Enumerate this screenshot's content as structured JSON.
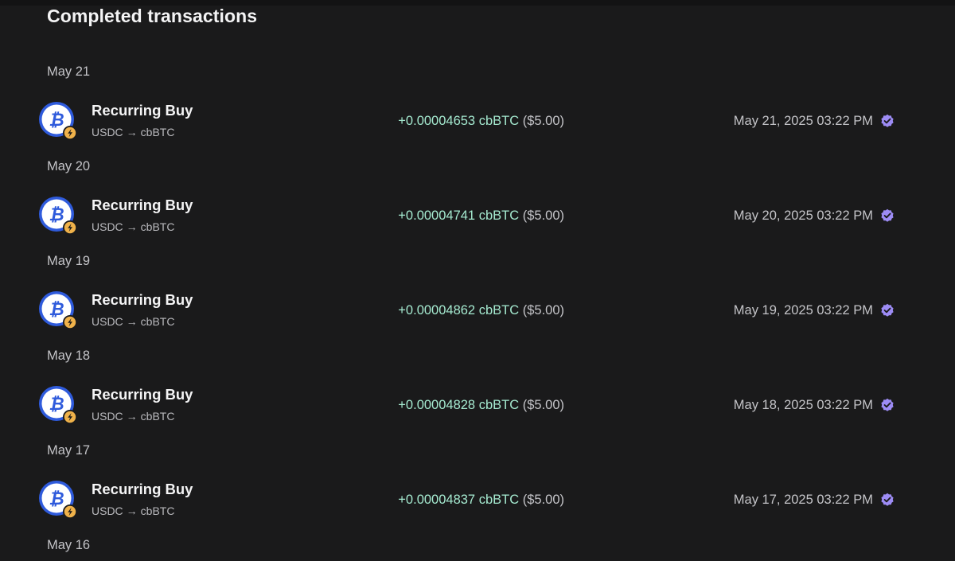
{
  "page": {
    "title": "Completed transactions"
  },
  "colors": {
    "background": "#1a1a1b",
    "amount_positive": "#a5ead0",
    "secondary_text": "#c4c4c8",
    "verified_badge": "#9d8cf5",
    "btc_blue": "#2f5bdc",
    "bolt_badge": "#f0b24a"
  },
  "groups": [
    {
      "date": "May 21",
      "transactions": [
        {
          "icon": "bitcoin-icon",
          "badge_icon": "lightning-bolt-icon",
          "title": "Recurring Buy",
          "from": "USDC",
          "arrow": "→",
          "to": "cbBTC",
          "amount": "+0.00004653 cbBTC",
          "usd": "($5.00)",
          "timestamp": "May 21, 2025 03:22 PM",
          "status_icon": "verified-check-icon"
        }
      ]
    },
    {
      "date": "May 20",
      "transactions": [
        {
          "icon": "bitcoin-icon",
          "badge_icon": "lightning-bolt-icon",
          "title": "Recurring Buy",
          "from": "USDC",
          "arrow": "→",
          "to": "cbBTC",
          "amount": "+0.00004741 cbBTC",
          "usd": "($5.00)",
          "timestamp": "May 20, 2025 03:22 PM",
          "status_icon": "verified-check-icon"
        }
      ]
    },
    {
      "date": "May 19",
      "transactions": [
        {
          "icon": "bitcoin-icon",
          "badge_icon": "lightning-bolt-icon",
          "title": "Recurring Buy",
          "from": "USDC",
          "arrow": "→",
          "to": "cbBTC",
          "amount": "+0.00004862 cbBTC",
          "usd": "($5.00)",
          "timestamp": "May 19, 2025 03:22 PM",
          "status_icon": "verified-check-icon"
        }
      ]
    },
    {
      "date": "May 18",
      "transactions": [
        {
          "icon": "bitcoin-icon",
          "badge_icon": "lightning-bolt-icon",
          "title": "Recurring Buy",
          "from": "USDC",
          "arrow": "→",
          "to": "cbBTC",
          "amount": "+0.00004828 cbBTC",
          "usd": "($5.00)",
          "timestamp": "May 18, 2025 03:22 PM",
          "status_icon": "verified-check-icon"
        }
      ]
    },
    {
      "date": "May 17",
      "transactions": [
        {
          "icon": "bitcoin-icon",
          "badge_icon": "lightning-bolt-icon",
          "title": "Recurring Buy",
          "from": "USDC",
          "arrow": "→",
          "to": "cbBTC",
          "amount": "+0.00004837 cbBTC",
          "usd": "($5.00)",
          "timestamp": "May 17, 2025 03:22 PM",
          "status_icon": "verified-check-icon"
        }
      ]
    },
    {
      "date": "May 16",
      "transactions": []
    }
  ]
}
